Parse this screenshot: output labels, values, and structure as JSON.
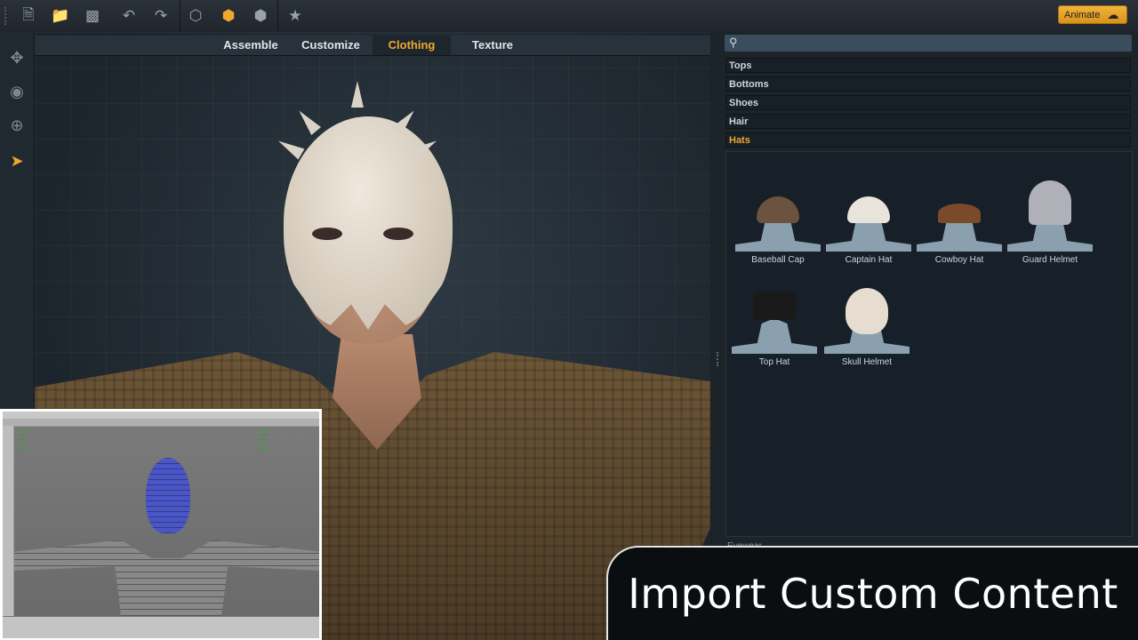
{
  "toolbar": {
    "buttons": [
      "new-file-icon",
      "open-folder-icon",
      "save-icon",
      "undo-icon",
      "redo-icon",
      "wireframe-cube-icon",
      "solid-cube-icon",
      "textured-cube-icon",
      "star-icon"
    ],
    "animate_label": "Animate"
  },
  "left_tools": [
    "move-icon",
    "rotate-icon",
    "target-icon",
    "pointer-icon"
  ],
  "tabs": [
    {
      "label": "Assemble"
    },
    {
      "label": "Customize"
    },
    {
      "label": "Clothing"
    },
    {
      "label": "Texture"
    }
  ],
  "active_tab": "Clothing",
  "search": {
    "placeholder": ""
  },
  "categories": [
    {
      "label": "Tops"
    },
    {
      "label": "Bottoms"
    },
    {
      "label": "Shoes"
    },
    {
      "label": "Hair"
    },
    {
      "label": "Hats"
    }
  ],
  "active_category": "Hats",
  "items": [
    {
      "label": "Baseball Cap",
      "color": "#6b5340"
    },
    {
      "label": "Captain Hat",
      "color": "#e8e4dc"
    },
    {
      "label": "Cowboy Hat",
      "color": "#7a4a2a"
    },
    {
      "label": "Guard Helmet",
      "color": "#b0b0b8"
    },
    {
      "label": "Top Hat",
      "color": "#1a1a1a"
    },
    {
      "label": "Skull Helmet",
      "color": "#e6ddd0"
    }
  ],
  "footer_category": "Eyewear",
  "banner": {
    "text": "Import Custom Content"
  },
  "accent_color": "#f0a830"
}
